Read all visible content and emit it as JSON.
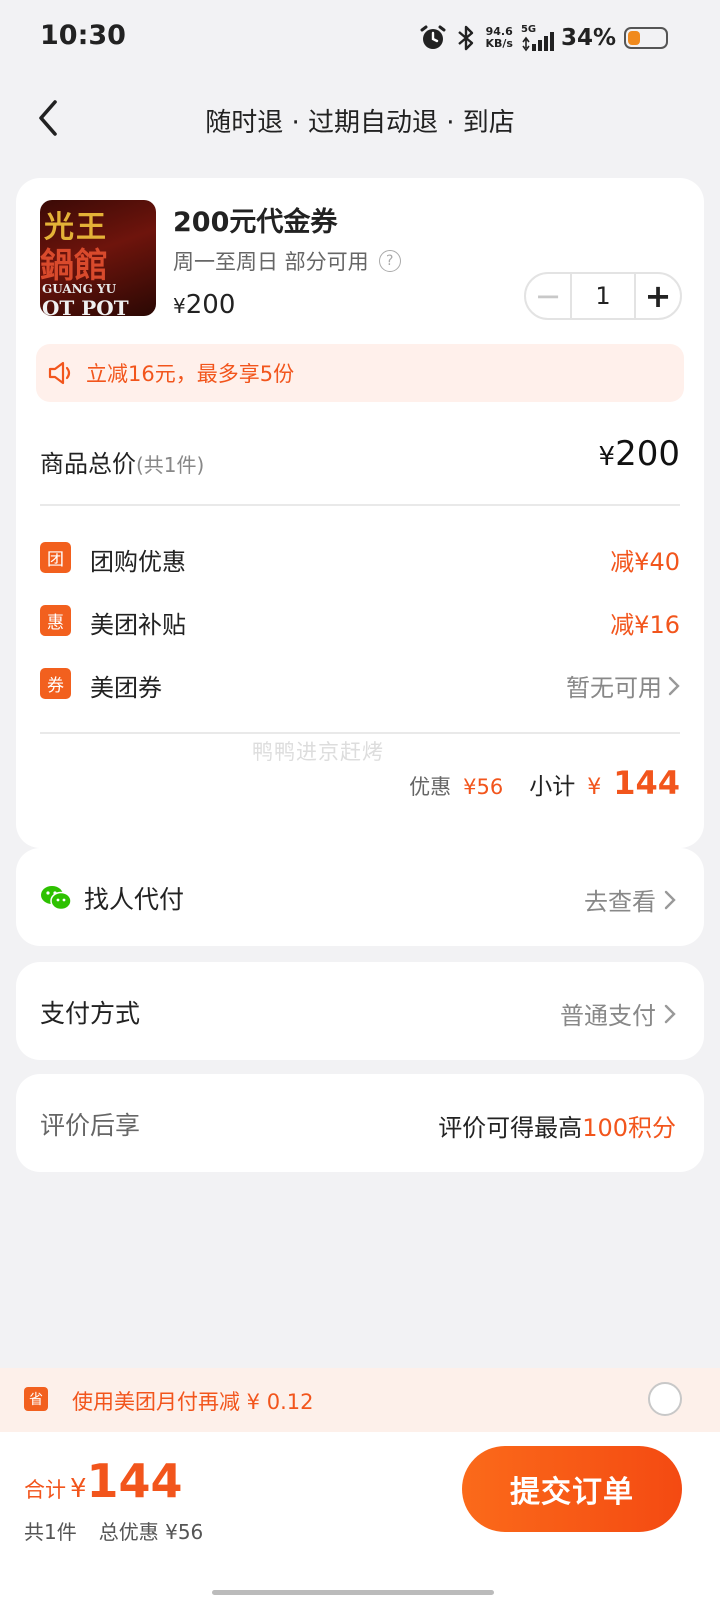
{
  "status": {
    "time": "10:30",
    "speed_top": "94.6",
    "speed_bottom": "KB/s",
    "network": "5G",
    "battery_pct": "34%",
    "icons": [
      "alarm-icon",
      "bluetooth-icon",
      "signal-icon",
      "battery-icon"
    ]
  },
  "nav": {
    "title": "随时退 · 过期自动退 · 到店",
    "back_icon": "chevron-left-icon"
  },
  "product": {
    "thumb_text_1": "光王",
    "thumb_text_2": "鍋館",
    "thumb_text_3": "GUANG YU",
    "thumb_text_4": "OT POT",
    "title": "200元代金券",
    "subtitle": "周一至周日 部分可用",
    "help_glyph": "?",
    "price_symbol": "¥",
    "price": "200",
    "quantity": "1",
    "minus_label": "−",
    "plus_label": "+"
  },
  "promo": {
    "text": "立减16元，最多享5份"
  },
  "summary": {
    "total_label": "商品总价",
    "total_count": "(共1件)",
    "total_symbol": "¥",
    "total_value": "200",
    "discounts": [
      {
        "tag": "团",
        "label": "团购优惠",
        "value": "减¥40"
      },
      {
        "tag": "惠",
        "label": "美团补贴",
        "value": "减¥16"
      },
      {
        "tag": "券",
        "label": "美团券",
        "value": "暂无可用"
      }
    ],
    "watermark": "鸭鸭进京赶烤",
    "discount_label": "优惠",
    "discount_value": "¥56",
    "subtotal_label": "小计",
    "subtotal_symbol": "¥",
    "subtotal_value": "144"
  },
  "rows": {
    "pay_for_me_label": "找人代付",
    "pay_for_me_action": "去查看",
    "payment_label": "支付方式",
    "payment_value": "普通支付",
    "review_label": "评价后享",
    "review_text": "评价可得最高",
    "review_highlight": "100积分"
  },
  "monthpay": {
    "icon_glyph": "省",
    "text": "使用美团月付再减 ¥ 0.12"
  },
  "bottom": {
    "total_label": "合计",
    "total_symbol": "¥",
    "total_value": "144",
    "count": "共1件",
    "discount": "总优惠 ¥56",
    "submit": "提交订单"
  },
  "colors": {
    "accent": "#f2551c",
    "background": "#f2f2f4",
    "wechat": "#2dc100"
  }
}
